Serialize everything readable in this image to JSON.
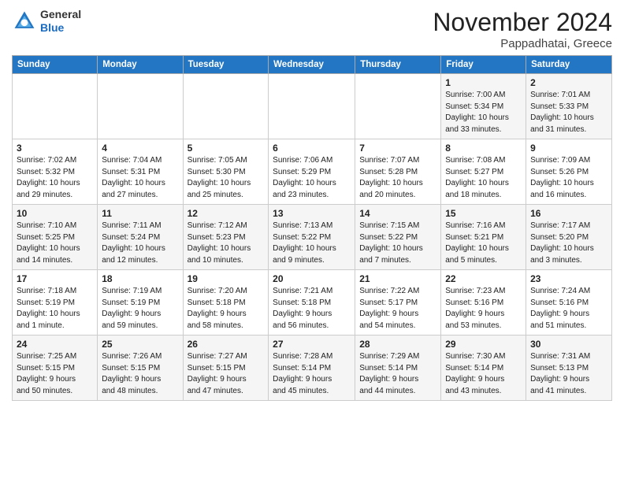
{
  "header": {
    "logo_line1": "General",
    "logo_line2": "Blue",
    "month": "November 2024",
    "location": "Pappadhatai, Greece"
  },
  "days_of_week": [
    "Sunday",
    "Monday",
    "Tuesday",
    "Wednesday",
    "Thursday",
    "Friday",
    "Saturday"
  ],
  "weeks": [
    [
      {
        "day": "",
        "info": ""
      },
      {
        "day": "",
        "info": ""
      },
      {
        "day": "",
        "info": ""
      },
      {
        "day": "",
        "info": ""
      },
      {
        "day": "",
        "info": ""
      },
      {
        "day": "1",
        "info": "Sunrise: 7:00 AM\nSunset: 5:34 PM\nDaylight: 10 hours\nand 33 minutes."
      },
      {
        "day": "2",
        "info": "Sunrise: 7:01 AM\nSunset: 5:33 PM\nDaylight: 10 hours\nand 31 minutes."
      }
    ],
    [
      {
        "day": "3",
        "info": "Sunrise: 7:02 AM\nSunset: 5:32 PM\nDaylight: 10 hours\nand 29 minutes."
      },
      {
        "day": "4",
        "info": "Sunrise: 7:04 AM\nSunset: 5:31 PM\nDaylight: 10 hours\nand 27 minutes."
      },
      {
        "day": "5",
        "info": "Sunrise: 7:05 AM\nSunset: 5:30 PM\nDaylight: 10 hours\nand 25 minutes."
      },
      {
        "day": "6",
        "info": "Sunrise: 7:06 AM\nSunset: 5:29 PM\nDaylight: 10 hours\nand 23 minutes."
      },
      {
        "day": "7",
        "info": "Sunrise: 7:07 AM\nSunset: 5:28 PM\nDaylight: 10 hours\nand 20 minutes."
      },
      {
        "day": "8",
        "info": "Sunrise: 7:08 AM\nSunset: 5:27 PM\nDaylight: 10 hours\nand 18 minutes."
      },
      {
        "day": "9",
        "info": "Sunrise: 7:09 AM\nSunset: 5:26 PM\nDaylight: 10 hours\nand 16 minutes."
      }
    ],
    [
      {
        "day": "10",
        "info": "Sunrise: 7:10 AM\nSunset: 5:25 PM\nDaylight: 10 hours\nand 14 minutes."
      },
      {
        "day": "11",
        "info": "Sunrise: 7:11 AM\nSunset: 5:24 PM\nDaylight: 10 hours\nand 12 minutes."
      },
      {
        "day": "12",
        "info": "Sunrise: 7:12 AM\nSunset: 5:23 PM\nDaylight: 10 hours\nand 10 minutes."
      },
      {
        "day": "13",
        "info": "Sunrise: 7:13 AM\nSunset: 5:22 PM\nDaylight: 10 hours\nand 9 minutes."
      },
      {
        "day": "14",
        "info": "Sunrise: 7:15 AM\nSunset: 5:22 PM\nDaylight: 10 hours\nand 7 minutes."
      },
      {
        "day": "15",
        "info": "Sunrise: 7:16 AM\nSunset: 5:21 PM\nDaylight: 10 hours\nand 5 minutes."
      },
      {
        "day": "16",
        "info": "Sunrise: 7:17 AM\nSunset: 5:20 PM\nDaylight: 10 hours\nand 3 minutes."
      }
    ],
    [
      {
        "day": "17",
        "info": "Sunrise: 7:18 AM\nSunset: 5:19 PM\nDaylight: 10 hours\nand 1 minute."
      },
      {
        "day": "18",
        "info": "Sunrise: 7:19 AM\nSunset: 5:19 PM\nDaylight: 9 hours\nand 59 minutes."
      },
      {
        "day": "19",
        "info": "Sunrise: 7:20 AM\nSunset: 5:18 PM\nDaylight: 9 hours\nand 58 minutes."
      },
      {
        "day": "20",
        "info": "Sunrise: 7:21 AM\nSunset: 5:18 PM\nDaylight: 9 hours\nand 56 minutes."
      },
      {
        "day": "21",
        "info": "Sunrise: 7:22 AM\nSunset: 5:17 PM\nDaylight: 9 hours\nand 54 minutes."
      },
      {
        "day": "22",
        "info": "Sunrise: 7:23 AM\nSunset: 5:16 PM\nDaylight: 9 hours\nand 53 minutes."
      },
      {
        "day": "23",
        "info": "Sunrise: 7:24 AM\nSunset: 5:16 PM\nDaylight: 9 hours\nand 51 minutes."
      }
    ],
    [
      {
        "day": "24",
        "info": "Sunrise: 7:25 AM\nSunset: 5:15 PM\nDaylight: 9 hours\nand 50 minutes."
      },
      {
        "day": "25",
        "info": "Sunrise: 7:26 AM\nSunset: 5:15 PM\nDaylight: 9 hours\nand 48 minutes."
      },
      {
        "day": "26",
        "info": "Sunrise: 7:27 AM\nSunset: 5:15 PM\nDaylight: 9 hours\nand 47 minutes."
      },
      {
        "day": "27",
        "info": "Sunrise: 7:28 AM\nSunset: 5:14 PM\nDaylight: 9 hours\nand 45 minutes."
      },
      {
        "day": "28",
        "info": "Sunrise: 7:29 AM\nSunset: 5:14 PM\nDaylight: 9 hours\nand 44 minutes."
      },
      {
        "day": "29",
        "info": "Sunrise: 7:30 AM\nSunset: 5:14 PM\nDaylight: 9 hours\nand 43 minutes."
      },
      {
        "day": "30",
        "info": "Sunrise: 7:31 AM\nSunset: 5:13 PM\nDaylight: 9 hours\nand 41 minutes."
      }
    ]
  ]
}
